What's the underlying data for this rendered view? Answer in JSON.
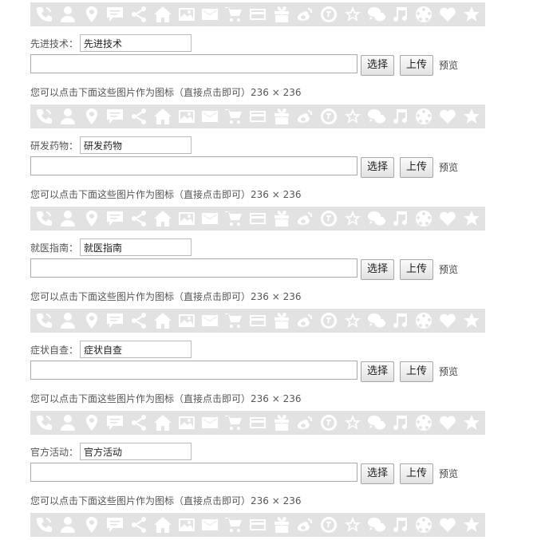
{
  "strip_icons": [
    "phone-icon",
    "user-icon",
    "location-pin-icon",
    "chat-bubble-icon",
    "share-icon",
    "home-icon",
    "image-icon",
    "mail-icon",
    "cart-icon",
    "credit-card-icon",
    "gift-icon",
    "weibo-icon",
    "alipay-icon",
    "star-icon",
    "wechat-icon",
    "music-icon",
    "film-reel-icon",
    "heart-icon",
    "star-solid-icon"
  ],
  "colors": {
    "strip_bg": "#e2e2e2",
    "icon": "#ffffff"
  },
  "buttons": {
    "select": "选择",
    "upload": "上传",
    "preview": "预览"
  },
  "hint": "您可以点击下面这些图片作为图标（直接点击即可）236 × 236",
  "sections": [
    {
      "label": "先进技术：",
      "value": "先进技术"
    },
    {
      "label": "研发药物：",
      "value": "研发药物"
    },
    {
      "label": "就医指南：",
      "value": "就医指南"
    },
    {
      "label": "症状自查：",
      "value": "症状自查"
    },
    {
      "label": "官方活动：",
      "value": "官方活动"
    }
  ]
}
